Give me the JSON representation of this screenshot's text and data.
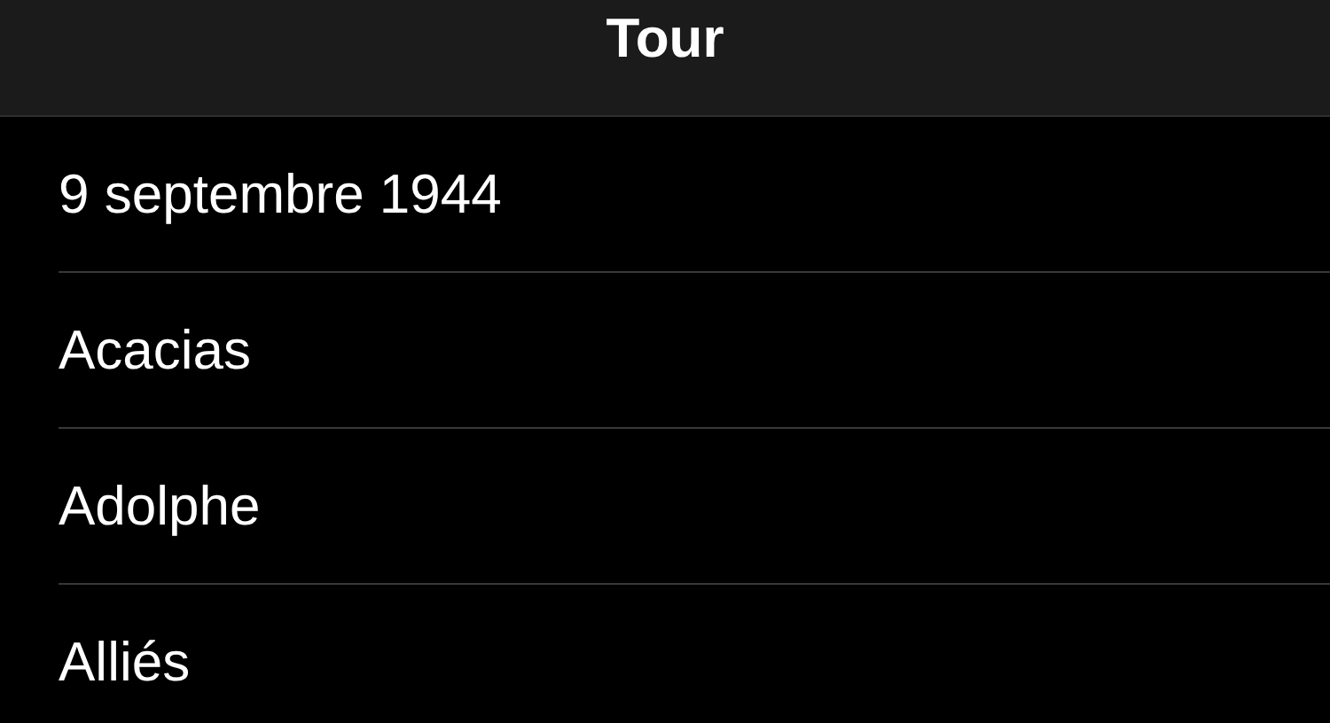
{
  "navigation_bar": {
    "title": "Tour"
  },
  "list": {
    "items": [
      {
        "label": "9 septembre 1944"
      },
      {
        "label": "Acacias"
      },
      {
        "label": "Adolphe"
      },
      {
        "label": "Alliés"
      }
    ]
  }
}
